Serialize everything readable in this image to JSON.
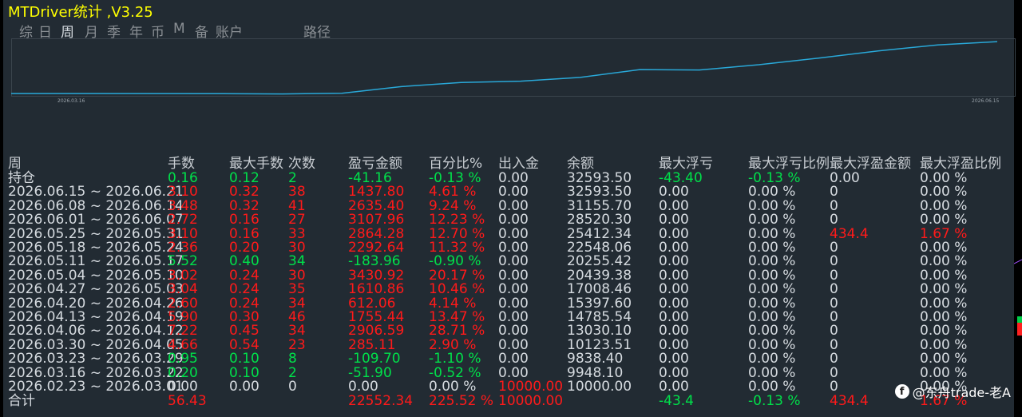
{
  "title": "MTDriver统计 ,V3.25",
  "tabs": [
    "综",
    "日",
    "周",
    "月",
    "季",
    "年",
    "币",
    "M",
    "备",
    "账户",
    "路径"
  ],
  "active_tab": 2,
  "chart": {
    "x_start_label": "2026.03.16",
    "x_end_label": "2026.06.15",
    "line_color": "#29a8d8",
    "balance": [
      9948.1,
      9838.4,
      10123.51,
      13030.1,
      14785.54,
      15397.6,
      17008.46,
      20439.38,
      20255.42,
      22548.06,
      25412.34,
      28520.3,
      31155.7,
      32593.5
    ]
  },
  "colors": {
    "green": "#00e04a",
    "red": "#ff1a1a",
    "white": "#d6dbe0",
    "title": "#ffff00"
  },
  "table": {
    "headers": [
      "周",
      "手数",
      "最大手数",
      "次数",
      "盈亏金额",
      "百分比%",
      "出入金",
      "余额",
      "最大浮亏",
      "最大浮亏比例",
      "最大浮盈金额",
      "最大浮盈比例"
    ],
    "rows": [
      {
        "period": "持仓",
        "lots": "0.16",
        "max_lots": "0.12",
        "count": "2",
        "pnl": "-41.16",
        "pct": "-0.13 %",
        "flow": "0.00",
        "balance": "32593.50",
        "max_dd": "-43.40",
        "max_dd_pct": "-0.13 %",
        "max_fp": "0.00",
        "max_fp_pct": "0.00 %",
        "tone": "g"
      },
      {
        "period": "2026.06.15 ~ 2026.06.21",
        "lots": "3.10",
        "max_lots": "0.32",
        "count": "38",
        "pnl": "1437.80",
        "pct": "4.61 %",
        "flow": "0.00",
        "balance": "32593.50",
        "max_dd": "0.00",
        "max_dd_pct": "0.00 %",
        "max_fp": "0",
        "max_fp_pct": "0.00 %",
        "tone": "r"
      },
      {
        "period": "2026.06.08 ~ 2026.06.14",
        "lots": "3.48",
        "max_lots": "0.32",
        "count": "41",
        "pnl": "2635.40",
        "pct": "9.24 %",
        "flow": "0.00",
        "balance": "31155.70",
        "max_dd": "0.00",
        "max_dd_pct": "0.00 %",
        "max_fp": "0",
        "max_fp_pct": "0.00 %",
        "tone": "r"
      },
      {
        "period": "2026.06.01 ~ 2026.06.07",
        "lots": "2.72",
        "max_lots": "0.16",
        "count": "27",
        "pnl": "3107.96",
        "pct": "12.23 %",
        "flow": "0.00",
        "balance": "28520.30",
        "max_dd": "0.00",
        "max_dd_pct": "0.00 %",
        "max_fp": "0",
        "max_fp_pct": "0.00 %",
        "tone": "r"
      },
      {
        "period": "2026.05.25 ~ 2026.05.31",
        "lots": "3.10",
        "max_lots": "0.16",
        "count": "33",
        "pnl": "2864.28",
        "pct": "12.70 %",
        "flow": "0.00",
        "balance": "25412.34",
        "max_dd": "0.00",
        "max_dd_pct": "0.00 %",
        "max_fp": "434.4",
        "max_fp_pct": "1.67 %",
        "tone": "r",
        "fp_red": true
      },
      {
        "period": "2026.05.18 ~ 2026.05.24",
        "lots": "2.36",
        "max_lots": "0.20",
        "count": "30",
        "pnl": "2292.64",
        "pct": "11.32 %",
        "flow": "0.00",
        "balance": "22548.06",
        "max_dd": "0.00",
        "max_dd_pct": "0.00 %",
        "max_fp": "0",
        "max_fp_pct": "0.00 %",
        "tone": "r"
      },
      {
        "period": "2026.05.11 ~ 2026.05.17",
        "lots": "5.52",
        "max_lots": "0.40",
        "count": "34",
        "pnl": "-183.96",
        "pct": "-0.90 %",
        "flow": "0.00",
        "balance": "20255.42",
        "max_dd": "0.00",
        "max_dd_pct": "0.00 %",
        "max_fp": "0",
        "max_fp_pct": "0.00 %",
        "tone": "g"
      },
      {
        "period": "2026.05.04 ~ 2026.05.10",
        "lots": "3.02",
        "max_lots": "0.24",
        "count": "30",
        "pnl": "3430.92",
        "pct": "20.17 %",
        "flow": "0.00",
        "balance": "20439.38",
        "max_dd": "0.00",
        "max_dd_pct": "0.00 %",
        "max_fp": "0",
        "max_fp_pct": "0.00 %",
        "tone": "r"
      },
      {
        "period": "2026.04.27 ~ 2026.05.03",
        "lots": "3.04",
        "max_lots": "0.24",
        "count": "35",
        "pnl": "1610.86",
        "pct": "10.46 %",
        "flow": "0.00",
        "balance": "17008.46",
        "max_dd": "0.00",
        "max_dd_pct": "0.00 %",
        "max_fp": "0",
        "max_fp_pct": "0.00 %",
        "tone": "r"
      },
      {
        "period": "2026.04.20 ~ 2026.04.26",
        "lots": "2.60",
        "max_lots": "0.24",
        "count": "34",
        "pnl": "612.06",
        "pct": "4.14 %",
        "flow": "0.00",
        "balance": "15397.60",
        "max_dd": "0.00",
        "max_dd_pct": "0.00 %",
        "max_fp": "0",
        "max_fp_pct": "0.00 %",
        "tone": "r"
      },
      {
        "period": "2026.04.13 ~ 2026.04.19",
        "lots": "5.90",
        "max_lots": "0.30",
        "count": "46",
        "pnl": "1755.44",
        "pct": "13.47 %",
        "flow": "0.00",
        "balance": "14785.54",
        "max_dd": "0.00",
        "max_dd_pct": "0.00 %",
        "max_fp": "0",
        "max_fp_pct": "0.00 %",
        "tone": "r"
      },
      {
        "period": "2026.04.06 ~ 2026.04.12",
        "lots": "7.22",
        "max_lots": "0.45",
        "count": "34",
        "pnl": "2906.59",
        "pct": "28.71 %",
        "flow": "0.00",
        "balance": "13030.10",
        "max_dd": "0.00",
        "max_dd_pct": "0.00 %",
        "max_fp": "0",
        "max_fp_pct": "0.00 %",
        "tone": "r"
      },
      {
        "period": "2026.03.30 ~ 2026.04.05",
        "lots": "4.66",
        "max_lots": "0.54",
        "count": "23",
        "pnl": "285.11",
        "pct": "2.90 %",
        "flow": "0.00",
        "balance": "10123.51",
        "max_dd": "0.00",
        "max_dd_pct": "0.00 %",
        "max_fp": "0",
        "max_fp_pct": "0.00 %",
        "tone": "r"
      },
      {
        "period": "2026.03.23 ~ 2026.03.29",
        "lots": "0.95",
        "max_lots": "0.10",
        "count": "8",
        "pnl": "-109.70",
        "pct": "-1.10 %",
        "flow": "0.00",
        "balance": "9838.40",
        "max_dd": "0.00",
        "max_dd_pct": "0.00 %",
        "max_fp": "0",
        "max_fp_pct": "0.00 %",
        "tone": "g"
      },
      {
        "period": "2026.03.16 ~ 2026.03.22",
        "lots": "0.20",
        "max_lots": "0.10",
        "count": "2",
        "pnl": "-51.90",
        "pct": "-0.52 %",
        "flow": "0.00",
        "balance": "9948.10",
        "max_dd": "0.00",
        "max_dd_pct": "0.00 %",
        "max_fp": "0",
        "max_fp_pct": "0.00 %",
        "tone": "g"
      },
      {
        "period": "2026.02.23 ~ 2026.03.01",
        "lots": "0.00",
        "max_lots": "0.00",
        "count": "0",
        "pnl": "0.00",
        "pct": "0.00 %",
        "flow": "10000.00",
        "balance": "10000.00",
        "max_dd": "0.00",
        "max_dd_pct": "0.00 %",
        "max_fp": "0",
        "max_fp_pct": "0.00 %",
        "tone": "w",
        "flow_red": true
      }
    ],
    "total": {
      "period": "合计",
      "lots": "56.43",
      "pnl": "22552.34",
      "pct": "225.52 %",
      "flow": "10000.00",
      "max_dd": "-43.4",
      "max_dd_pct": "-0.13 %",
      "max_fp": "434.4",
      "max_fp_pct": "1.67 %"
    }
  },
  "watermark": "@东舟trade-老A"
}
